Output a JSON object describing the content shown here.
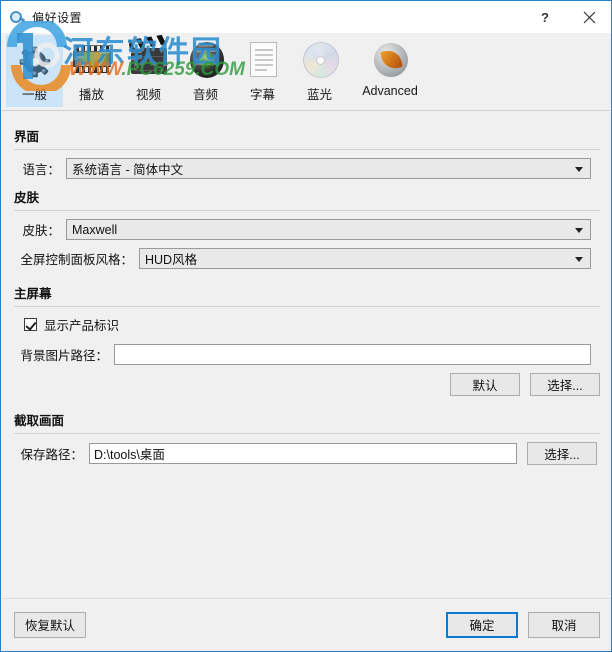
{
  "window": {
    "title": "偏好设置",
    "title_icon": "preferences-icon",
    "help_label": "?",
    "close_label": "✕",
    "border_color": "#2a7fc9"
  },
  "watermark": {
    "site_name": "河东软件园",
    "url_prefix": "WWW",
    "url_body": ".PC6259.COM",
    "logo_color": "#2e8fd0",
    "url_color": "#2f9b3c"
  },
  "tabs": [
    {
      "label": "一般",
      "icon": "gear-icon",
      "active": true
    },
    {
      "label": "播放",
      "icon": "film-icon",
      "active": false
    },
    {
      "label": "视频",
      "icon": "clapper-icon",
      "active": false
    },
    {
      "label": "音频",
      "icon": "speaker-icon",
      "active": false
    },
    {
      "label": "字幕",
      "icon": "document-icon",
      "active": false
    },
    {
      "label": "蓝光",
      "icon": "disc-icon",
      "active": false
    },
    {
      "label": "Advanced",
      "icon": "advanced-icon",
      "active": false
    }
  ],
  "sections": {
    "interface": {
      "title": "界面",
      "language_label": "语言：",
      "language_value": "系统语言 - 简体中文"
    },
    "skin": {
      "title": "皮肤",
      "skin_label": "皮肤：",
      "skin_value": "Maxwell",
      "panel_label": "全屏控制面板风格：",
      "panel_value": "HUD风格"
    },
    "mainscreen": {
      "title": "主屏幕",
      "show_logo_label": "显示产品标识",
      "show_logo_checked": true,
      "bg_path_label": "背景图片路径：",
      "bg_path_value": "",
      "default_button": "默认",
      "browse_button": "选择..."
    },
    "capture": {
      "title": "截取画面",
      "save_path_label": "保存路径：",
      "save_path_value": "D:\\tools\\桌面",
      "browse_button": "选择..."
    }
  },
  "footer": {
    "restore_defaults": "恢复默认",
    "ok": "确定",
    "cancel": "取消",
    "ok_focus_color": "#0a7bce"
  }
}
